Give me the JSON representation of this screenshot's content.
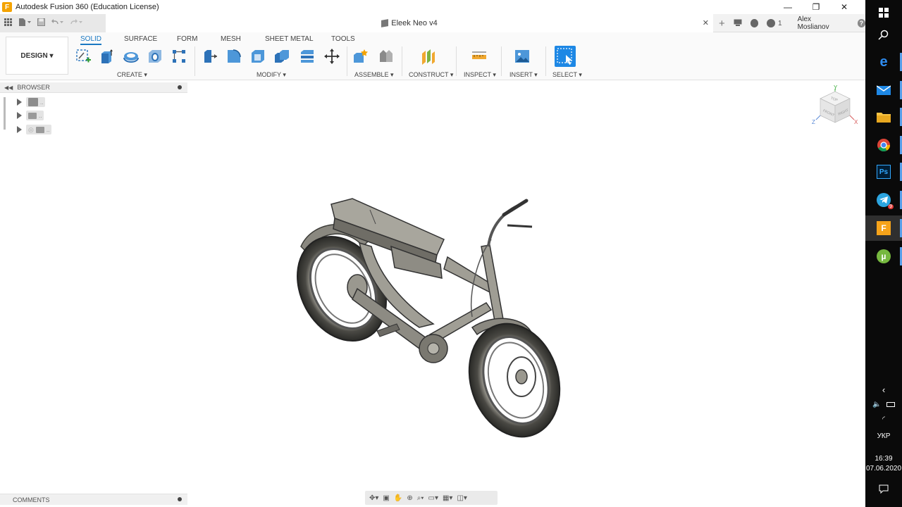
{
  "window": {
    "app_icon_letter": "F",
    "title": "Autodesk Fusion 360 (Education License)",
    "minimize_label": "—",
    "restore_label": "❐",
    "close_label": "✕"
  },
  "document": {
    "title": "Eleek Neo v4",
    "close_label": "✕"
  },
  "header": {
    "job_count": "1",
    "user_name": "Alex Moslianov",
    "help_label": "?"
  },
  "ribbon": {
    "workspace_label": "DESIGN ▾",
    "tabs": [
      {
        "label": "SOLID",
        "active": true
      },
      {
        "label": "SURFACE",
        "active": false
      },
      {
        "label": "FORM",
        "active": false
      },
      {
        "label": "MESH",
        "active": false
      },
      {
        "label": "SHEET METAL",
        "active": false
      },
      {
        "label": "TOOLS",
        "active": false
      }
    ],
    "groups": {
      "create": "CREATE ▾",
      "modify": "MODIFY ▾",
      "assemble": "ASSEMBLE ▾",
      "construct": "CONSTRUCT ▾",
      "inspect": "INSPECT ▾",
      "insert": "INSERT ▾",
      "select": "SELECT ▾"
    },
    "accent_color": "#1a78c2"
  },
  "browser": {
    "label": "BROWSER",
    "nodes": [
      {
        "icon": "settings-icon"
      },
      {
        "icon": "folder-icon"
      },
      {
        "icon": "eye-folder-icon"
      }
    ]
  },
  "comments": {
    "label": "COMMENTS"
  },
  "viewcube": {
    "top": "TOP",
    "front": "FRONT",
    "right": "RIGHT",
    "axis_x": "X",
    "axis_y": "Y",
    "axis_z": "Z"
  },
  "taskbar": {
    "language": "УКР",
    "time": "16:39",
    "date": "07.06.2020",
    "telegram_badge": "9"
  }
}
